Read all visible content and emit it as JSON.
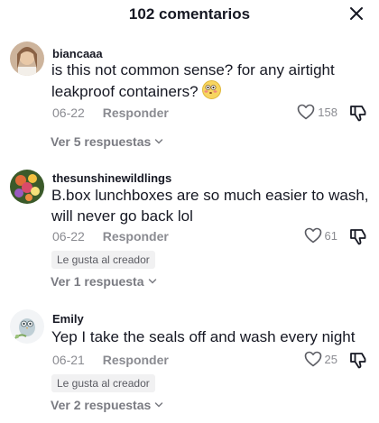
{
  "header": {
    "title": "102 comentarios",
    "close_icon": "close-icon"
  },
  "comments": [
    {
      "username": "biancaaa",
      "text": "is this not common sense? for any airtight leakproof containers?",
      "emoji": "flushed-face-icon",
      "date": "06-22",
      "reply_label": "Responder",
      "likes": "158",
      "view_replies": "Ver 5 respuestas"
    },
    {
      "username": "thesunshinewildlings",
      "text": "B.box lunchboxes are so much easier to wash, will never go back lol",
      "date": "06-22",
      "reply_label": "Responder",
      "likes": "61",
      "creator_badge": "Le gusta al creador",
      "view_replies": "Ver 1 respuesta"
    },
    {
      "username": "Emily",
      "text": "Yep I take the seals off and wash every night",
      "date": "06-21",
      "reply_label": "Responder",
      "likes": "25",
      "creator_badge": "Le gusta al creador",
      "view_replies": "Ver 2 respuestas"
    }
  ],
  "colors": {
    "text": "#161823",
    "muted": "#8a8b91",
    "badge_bg": "#f1f1f2"
  }
}
